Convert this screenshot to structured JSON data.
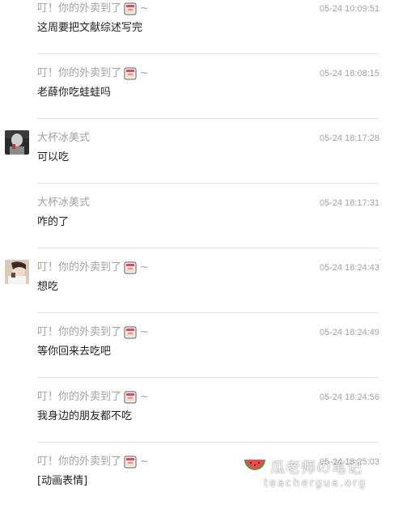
{
  "messages": [
    {
      "sender": "叮！你的外卖到了",
      "emoji": "cup-icon",
      "suffix": "~",
      "time": "05-24 10:09:51",
      "content": "这周要把文献综述写完",
      "avatar": ""
    },
    {
      "sender": "叮！你的外卖到了",
      "emoji": "cup-icon",
      "suffix": "~",
      "time": "05-24 18:08:15",
      "content": "老薛你吃蛙蛙吗",
      "avatar": ""
    },
    {
      "sender": "大杯冰美式",
      "emoji": "",
      "suffix": "",
      "time": "05-24 18:17:28",
      "content": "可以吃",
      "avatar": "dark-portrait-avatar"
    },
    {
      "sender": "大杯冰美式",
      "emoji": "",
      "suffix": "",
      "time": "05-24 18:17:31",
      "content": "咋的了",
      "avatar": ""
    },
    {
      "sender": "叮！你的外卖到了",
      "emoji": "cup-icon",
      "suffix": "~",
      "time": "05-24 18:24:43",
      "content": "想吃",
      "avatar": "light-portrait-avatar"
    },
    {
      "sender": "叮！你的外卖到了",
      "emoji": "cup-icon",
      "suffix": "~",
      "time": "05-24 18:24:49",
      "content": "等你回来去吃吧",
      "avatar": ""
    },
    {
      "sender": "叮！你的外卖到了",
      "emoji": "cup-icon",
      "suffix": "~",
      "time": "05-24 18:24:56",
      "content": "我身边的朋友都不吃",
      "avatar": ""
    },
    {
      "sender": "叮！你的外卖到了",
      "emoji": "cup-icon",
      "suffix": "~",
      "time": "05-24 18:25:03",
      "content": "[动画表情]",
      "avatar": ""
    }
  ],
  "watermark": {
    "title": "瓜老师の笔记",
    "url": "teachergua.org",
    "logo": "watermelon-icon"
  },
  "colors": {
    "sender": "#a3a3a3",
    "time": "#a3a3a3",
    "content": "#222222",
    "divider": "#e6e6e6",
    "background": "#ffffff"
  }
}
